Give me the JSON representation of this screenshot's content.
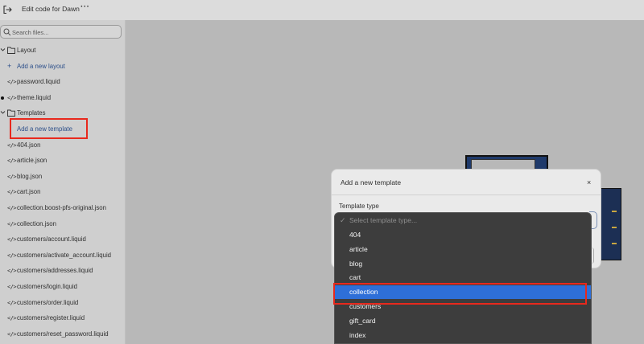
{
  "header": {
    "exit_icon": "exit-icon",
    "title": "Edit code for Dawn",
    "more_icon": "more-horizontal-icon"
  },
  "sidebar": {
    "search": {
      "placeholder": "Search files..."
    },
    "layout_folder": {
      "label": "Layout",
      "add_label": "Add a new layout",
      "files": [
        "password.liquid",
        "theme.liquid"
      ]
    },
    "templates_folder": {
      "label": "Templates",
      "add_label": "Add a new template",
      "files": [
        "404.json",
        "article.json",
        "blog.json",
        "cart.json",
        "collection.boost-pfs-original.json",
        "collection.json",
        "customers/account.liquid",
        "customers/activate_account.liquid",
        "customers/addresses.liquid",
        "customers/login.liquid",
        "customers/order.liquid",
        "customers/register.liquid",
        "customers/reset_password.liquid"
      ]
    },
    "code_glyph": "</>",
    "plus_glyph": "+"
  },
  "modal": {
    "title": "Add a new template",
    "close_glyph": "×",
    "field_label": "Template type"
  },
  "dropdown": {
    "placeholder": "Select template type...",
    "check_glyph": "✓",
    "options": [
      "404",
      "article",
      "blog",
      "cart",
      "collection",
      "customers",
      "gift_card",
      "index"
    ],
    "selected": "collection"
  },
  "colors": {
    "highlight": "#e8291d",
    "selected_option": "#2e6fd8",
    "link": "#2c4f8a"
  }
}
